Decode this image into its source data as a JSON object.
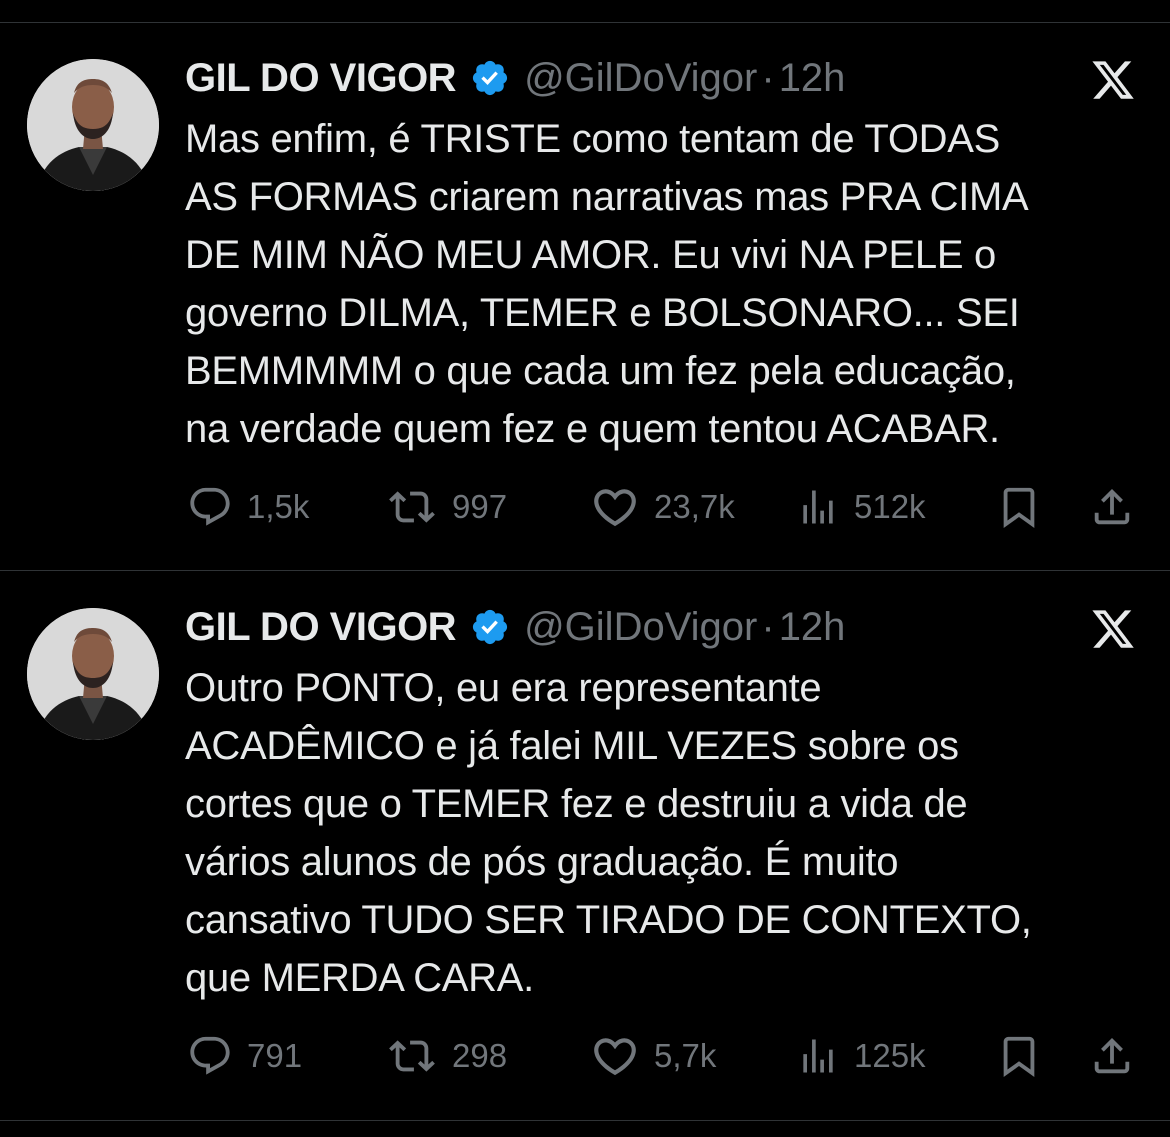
{
  "colors": {
    "background": "#000000",
    "text_primary": "#e7e9ea",
    "text_secondary": "#71767b",
    "verified_badge": "#1d9bf0",
    "divider": "#2f3336"
  },
  "tweets": [
    {
      "display_name": "GIL DO VIGOR",
      "verified_icon": "verified-badge-icon",
      "handle": "@GilDoVigor",
      "separator": "·",
      "time": "12h",
      "text": "Mas enfim, é TRISTE como tentam de TODAS\nAS FORMAS criarem narrativas mas PRA CIMA\nDE MIM NÃO MEU AMOR. Eu vivi NA PELE o\ngoverno DILMA, TEMER e BOLSONARO... SEI\nBEMMMMM o que cada um fez pela educação,\nna verdade quem fez e quem tentou ACABAR.",
      "replies": "1,5k",
      "retweets": "997",
      "likes": "23,7k",
      "views": "512k"
    },
    {
      "display_name": "GIL DO VIGOR",
      "verified_icon": "verified-badge-icon",
      "handle": "@GilDoVigor",
      "separator": "·",
      "time": "12h",
      "text": "Outro PONTO, eu era representante\nACADÊMICO e já falei MIL VEZES sobre os\ncortes que o TEMER fez e destruiu a vida de\nvários alunos de pós graduação. É muito\ncansativo TUDO SER TIRADO DE CONTEXTO,\nque MERDA CARA.",
      "replies": "791",
      "retweets": "298",
      "likes": "5,7k",
      "views": "125k"
    }
  ]
}
